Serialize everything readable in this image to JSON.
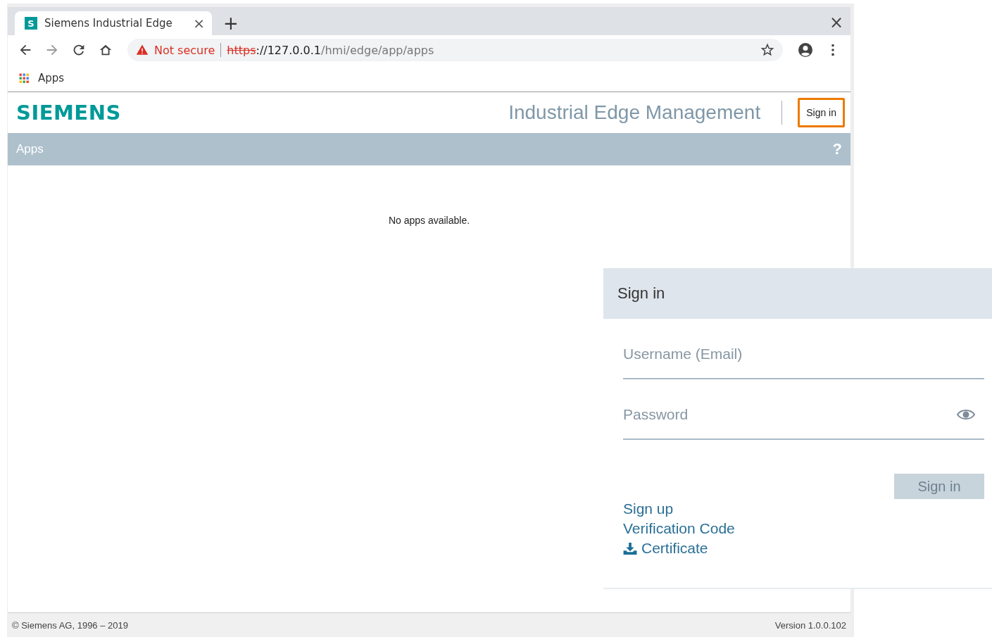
{
  "browser": {
    "tab": {
      "favicon": "S",
      "title": "Siemens Industrial Edge",
      "close": "×"
    },
    "new_tab": "+",
    "window_close": "×",
    "security": "Not secure",
    "url": {
      "scheme": "https",
      "host": "://127.0.0.1",
      "path": "/hmi/edge/app/apps"
    },
    "bookmarks": [
      "Apps"
    ]
  },
  "header": {
    "logo": "SIEMENS",
    "title": "Industrial Edge Management",
    "sign_in_button": {
      "label": "Sign in",
      "highlighted": true
    }
  },
  "apps_bar": {
    "title": "Apps",
    "help": "?"
  },
  "content": {
    "message": "No apps available."
  },
  "sign_in_panel": {
    "title": "Sign in",
    "fields": [
      {
        "placeholder": "Username (Email)",
        "kind": "text"
      },
      {
        "placeholder": "Password",
        "kind": "password"
      }
    ],
    "submit": {
      "label": "Sign in",
      "disabled": true
    },
    "links": [
      {
        "label": "Sign up",
        "kind": "link"
      },
      {
        "label": "Verification Code",
        "kind": "link"
      },
      {
        "label": "Certificate",
        "kind": "download"
      }
    ]
  },
  "footer": {
    "copyright": "© Siemens AG, 1996 – 2019",
    "version": "Version 1.0.0.102"
  }
}
